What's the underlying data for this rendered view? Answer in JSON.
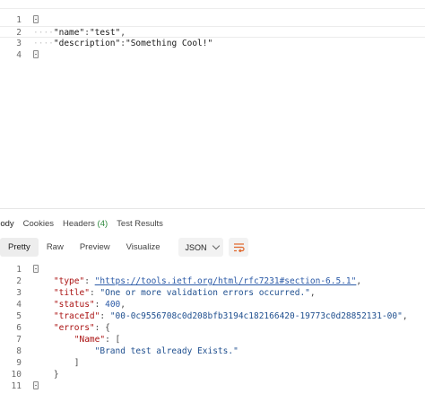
{
  "request_body": {
    "line_numbers": [
      "1",
      "2",
      "3",
      "4"
    ],
    "line2": {
      "key": "\"name\"",
      "colon": ":",
      "value": "\"test\"",
      "comma": ","
    },
    "line3": {
      "key": "\"description\"",
      "colon": ":",
      "value": "\"Something Cool!\""
    }
  },
  "response_tabs": {
    "body": "Body",
    "cookies": "Cookies",
    "headers": "Headers",
    "headers_count": "(4)",
    "test_results": "Test Results"
  },
  "view_toolbar": {
    "pretty": "Pretty",
    "raw": "Raw",
    "preview": "Preview",
    "visualize": "Visualize",
    "format": "JSON"
  },
  "response_body": {
    "line_numbers": [
      "1",
      "2",
      "3",
      "4",
      "5",
      "6",
      "7",
      "8",
      "9",
      "10",
      "11"
    ],
    "type_key": "\"type\"",
    "type_value": "\"https://tools.ietf.org/html/rfc7231#section-6.5.1\"",
    "title_key": "\"title\"",
    "title_value": "\"One or more validation errors occurred.\"",
    "status_key": "\"status\"",
    "status_value": "400",
    "traceid_key": "\"traceId\"",
    "traceid_value": "\"00-0c9556708c0d208bfb3194c182166420-19773c0d28852131-00\"",
    "errors_key": "\"errors\"",
    "name_key": "\"Name\"",
    "name_value": "\"Brand test already Exists.\""
  }
}
